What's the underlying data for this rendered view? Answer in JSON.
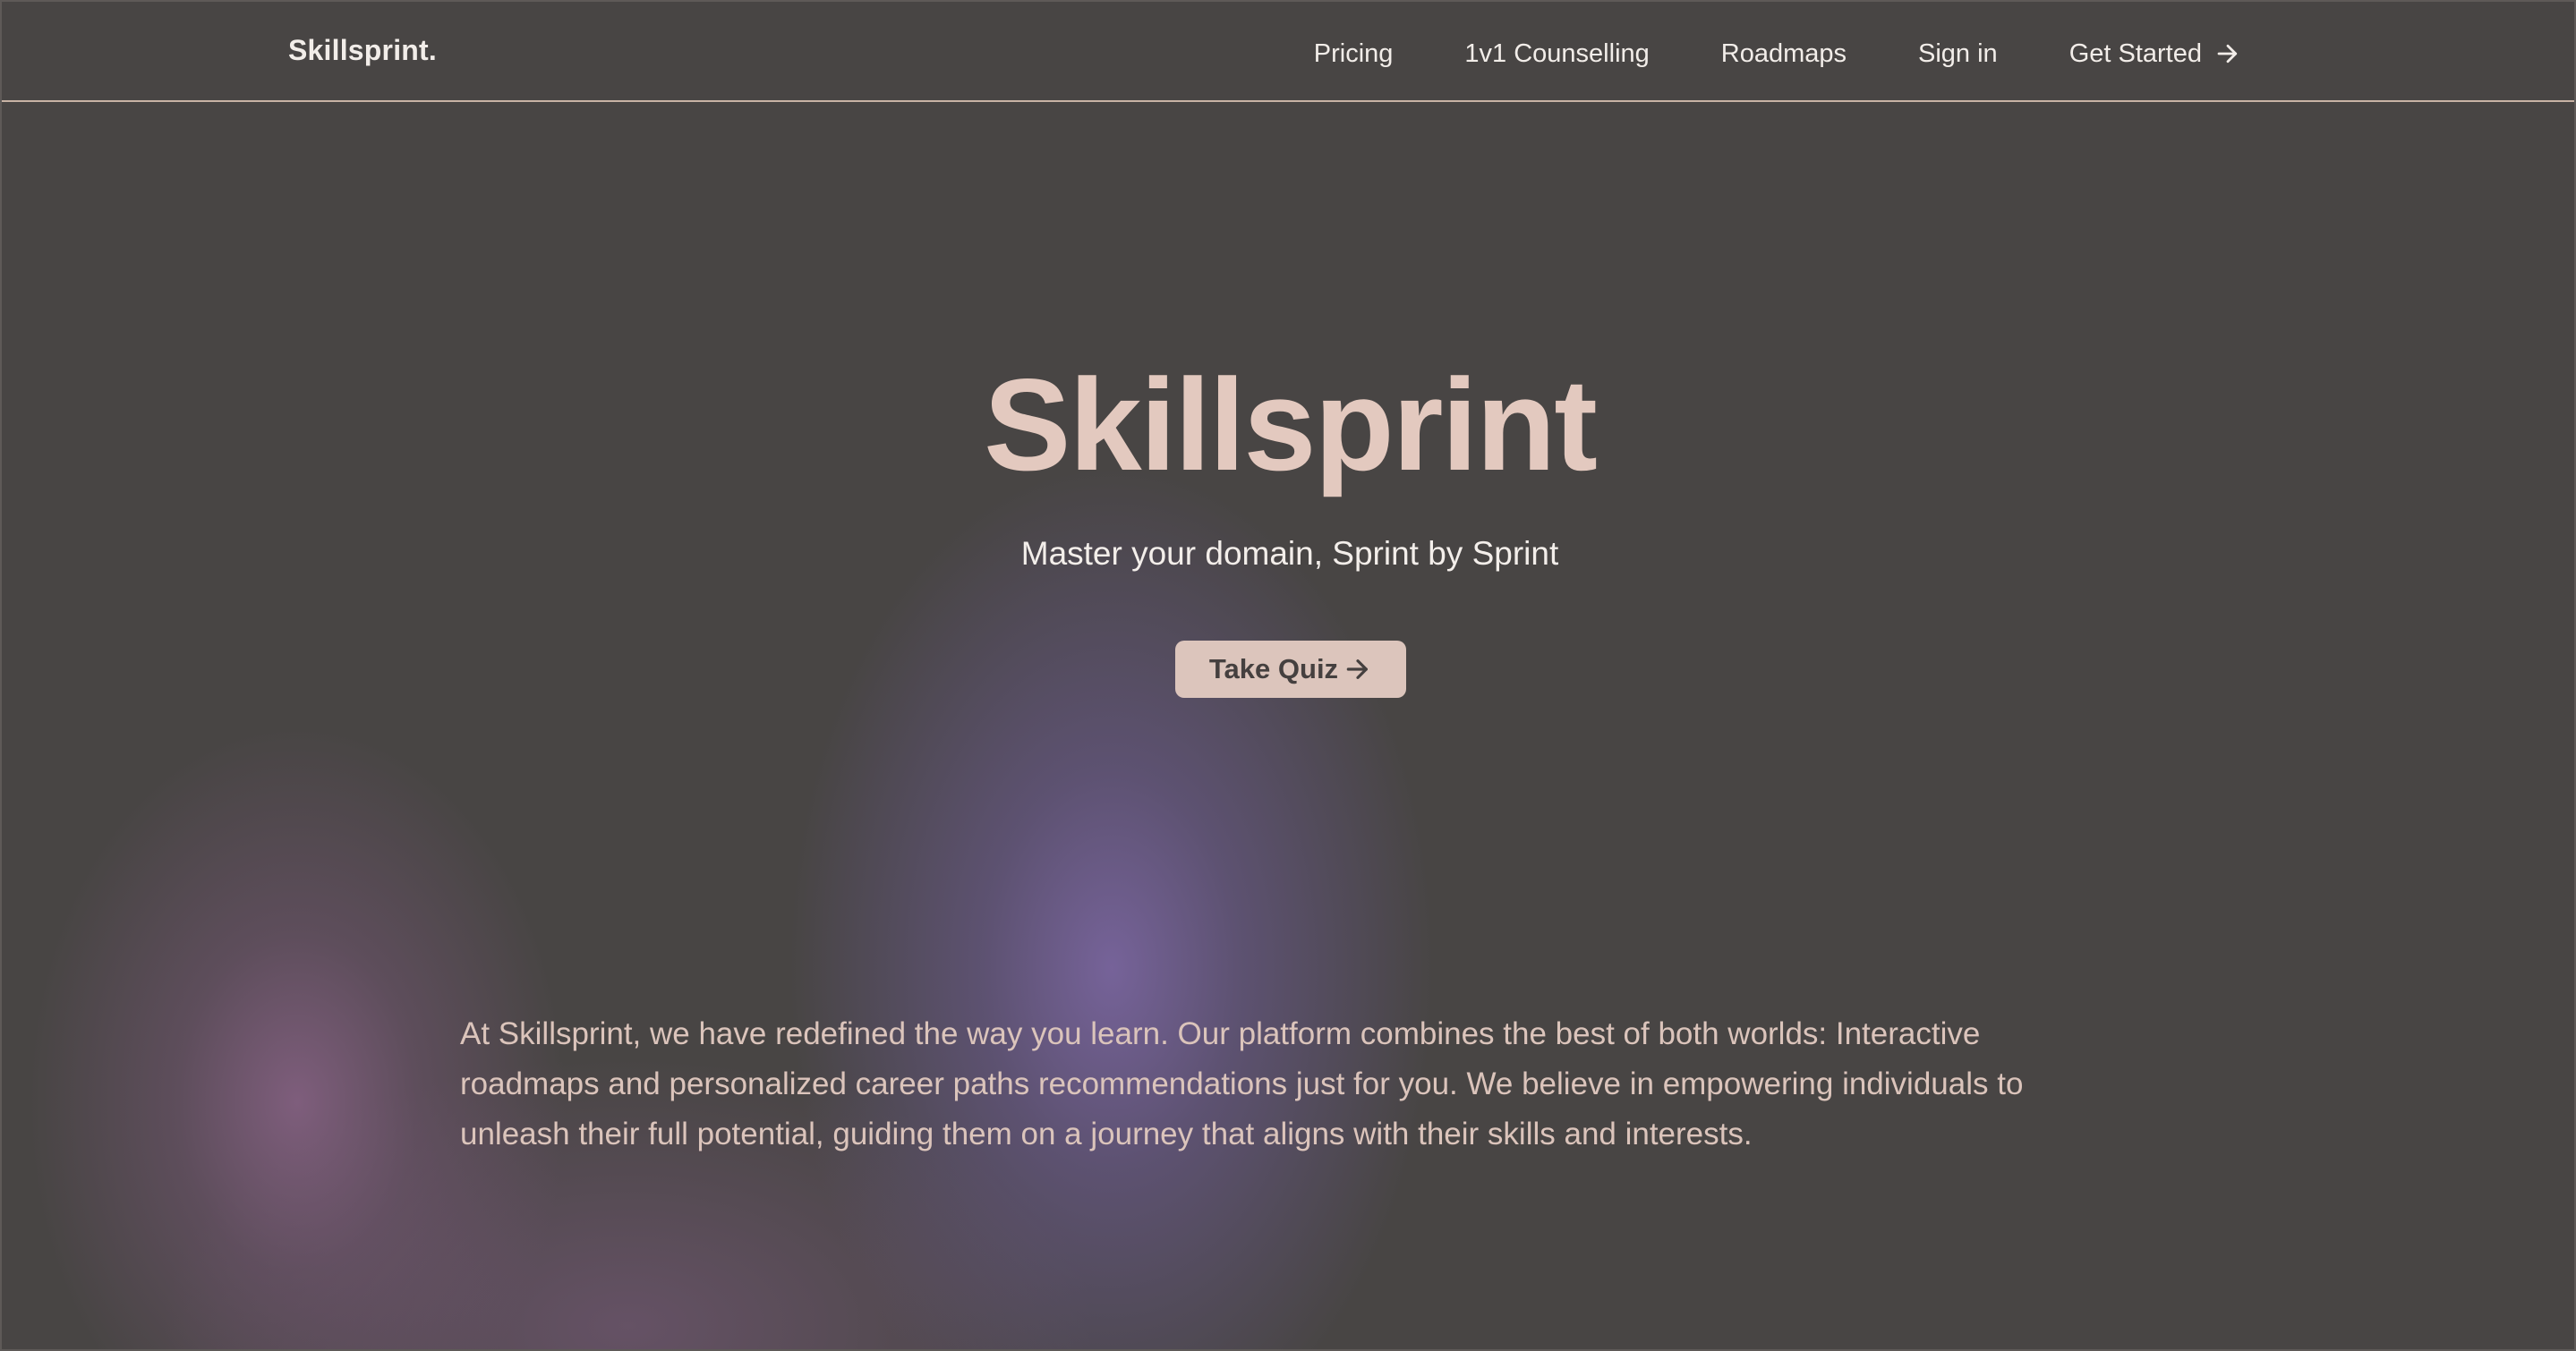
{
  "navbar": {
    "brand": "Skillsprint.",
    "links": [
      {
        "label": "Pricing"
      },
      {
        "label": "1v1 Counselling"
      },
      {
        "label": "Roadmaps"
      },
      {
        "label": "Sign in"
      }
    ],
    "cta": {
      "label": "Get Started",
      "icon": "arrow-right-icon"
    }
  },
  "hero": {
    "title": "Skillsprint",
    "tagline": "Master your domain, Sprint by Sprint",
    "button": {
      "label": "Take Quiz",
      "icon": "arrow-right-icon"
    }
  },
  "about": {
    "text": "At Skillsprint, we have redefined the way you learn. Our platform combines the best of both worlds: Interactive roadmaps and personalized career paths recommendations just for you. We believe in empowering individuals to unleash their full potential, guiding them on a journey that aligns with their skills and interests."
  },
  "colors": {
    "background": "#484544",
    "accent": "#e3c9bf",
    "button_bg": "#dcc5bc",
    "nav_text": "#f2ede9",
    "body_text": "#dbc4bb",
    "glow_purple": "#7e68a8",
    "glow_mauve": "#886286"
  }
}
